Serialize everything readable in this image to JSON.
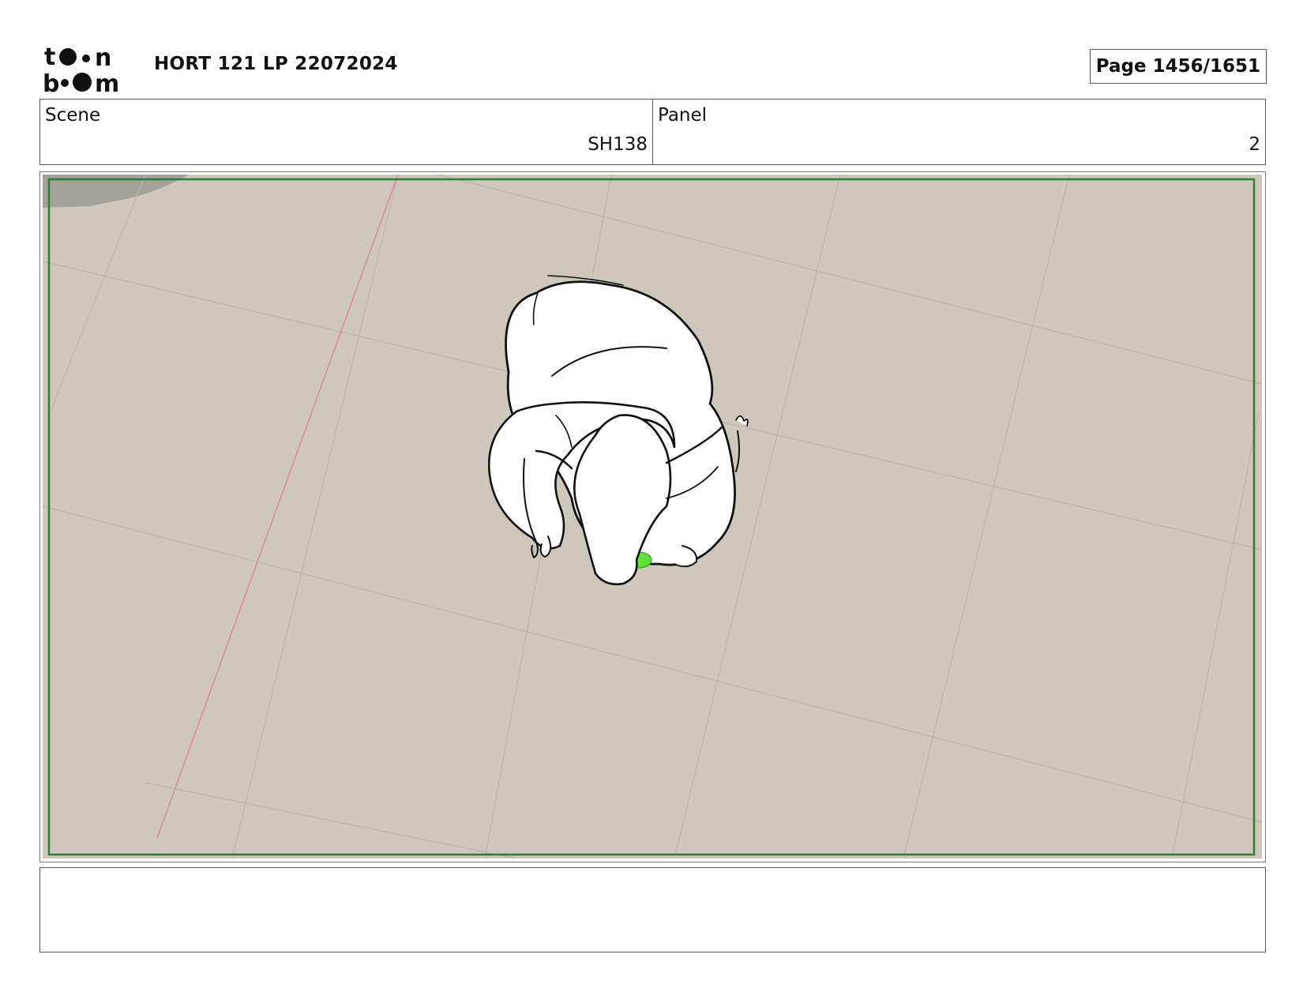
{
  "header": {
    "logo_alt": "toon boom",
    "title": "HORT 121 LP 22072024",
    "page_label": "Page 1456/1651"
  },
  "scene": {
    "label": "Scene",
    "value": "SH138"
  },
  "panel": {
    "label": "Panel",
    "value": "2"
  },
  "artwork": {
    "floor_color": "#cfc7bc",
    "frame_color": "#2e7d32",
    "accent_green": "#5fe03a",
    "character": "white elephant from top view"
  },
  "notes": {
    "text": ""
  }
}
